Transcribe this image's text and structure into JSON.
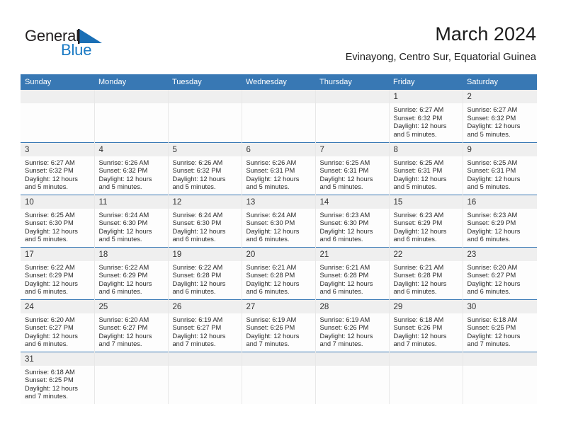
{
  "brand": {
    "name_part1": "General",
    "name_part2": "Blue",
    "logo_icon": "blue-flag-triangle",
    "color_dark": "#231f20",
    "color_blue": "#1a7ac4"
  },
  "header": {
    "month_title": "March 2024",
    "location": "Evinayong, Centro Sur, Equatorial Guinea"
  },
  "theme": {
    "header_blue": "#3878b4",
    "daynum_band": "#efefef",
    "cell_bg": "#fdfdfd",
    "text": "#2b2b2b"
  },
  "weekday_headers": [
    "Sunday",
    "Monday",
    "Tuesday",
    "Wednesday",
    "Thursday",
    "Friday",
    "Saturday"
  ],
  "weeks": [
    [
      {
        "day": "",
        "empty": true,
        "sunrise": "",
        "sunset": "",
        "daylight_line1": "",
        "daylight_line2": ""
      },
      {
        "day": "",
        "empty": true,
        "sunrise": "",
        "sunset": "",
        "daylight_line1": "",
        "daylight_line2": ""
      },
      {
        "day": "",
        "empty": true,
        "sunrise": "",
        "sunset": "",
        "daylight_line1": "",
        "daylight_line2": ""
      },
      {
        "day": "",
        "empty": true,
        "sunrise": "",
        "sunset": "",
        "daylight_line1": "",
        "daylight_line2": ""
      },
      {
        "day": "",
        "empty": true,
        "sunrise": "",
        "sunset": "",
        "daylight_line1": "",
        "daylight_line2": ""
      },
      {
        "day": "1",
        "empty": false,
        "sunrise": "Sunrise: 6:27 AM",
        "sunset": "Sunset: 6:32 PM",
        "daylight_line1": "Daylight: 12 hours",
        "daylight_line2": "and 5 minutes."
      },
      {
        "day": "2",
        "empty": false,
        "sunrise": "Sunrise: 6:27 AM",
        "sunset": "Sunset: 6:32 PM",
        "daylight_line1": "Daylight: 12 hours",
        "daylight_line2": "and 5 minutes."
      }
    ],
    [
      {
        "day": "3",
        "empty": false,
        "sunrise": "Sunrise: 6:27 AM",
        "sunset": "Sunset: 6:32 PM",
        "daylight_line1": "Daylight: 12 hours",
        "daylight_line2": "and 5 minutes."
      },
      {
        "day": "4",
        "empty": false,
        "sunrise": "Sunrise: 6:26 AM",
        "sunset": "Sunset: 6:32 PM",
        "daylight_line1": "Daylight: 12 hours",
        "daylight_line2": "and 5 minutes."
      },
      {
        "day": "5",
        "empty": false,
        "sunrise": "Sunrise: 6:26 AM",
        "sunset": "Sunset: 6:32 PM",
        "daylight_line1": "Daylight: 12 hours",
        "daylight_line2": "and 5 minutes."
      },
      {
        "day": "6",
        "empty": false,
        "sunrise": "Sunrise: 6:26 AM",
        "sunset": "Sunset: 6:31 PM",
        "daylight_line1": "Daylight: 12 hours",
        "daylight_line2": "and 5 minutes."
      },
      {
        "day": "7",
        "empty": false,
        "sunrise": "Sunrise: 6:25 AM",
        "sunset": "Sunset: 6:31 PM",
        "daylight_line1": "Daylight: 12 hours",
        "daylight_line2": "and 5 minutes."
      },
      {
        "day": "8",
        "empty": false,
        "sunrise": "Sunrise: 6:25 AM",
        "sunset": "Sunset: 6:31 PM",
        "daylight_line1": "Daylight: 12 hours",
        "daylight_line2": "and 5 minutes."
      },
      {
        "day": "9",
        "empty": false,
        "sunrise": "Sunrise: 6:25 AM",
        "sunset": "Sunset: 6:31 PM",
        "daylight_line1": "Daylight: 12 hours",
        "daylight_line2": "and 5 minutes."
      }
    ],
    [
      {
        "day": "10",
        "empty": false,
        "sunrise": "Sunrise: 6:25 AM",
        "sunset": "Sunset: 6:30 PM",
        "daylight_line1": "Daylight: 12 hours",
        "daylight_line2": "and 5 minutes."
      },
      {
        "day": "11",
        "empty": false,
        "sunrise": "Sunrise: 6:24 AM",
        "sunset": "Sunset: 6:30 PM",
        "daylight_line1": "Daylight: 12 hours",
        "daylight_line2": "and 5 minutes."
      },
      {
        "day": "12",
        "empty": false,
        "sunrise": "Sunrise: 6:24 AM",
        "sunset": "Sunset: 6:30 PM",
        "daylight_line1": "Daylight: 12 hours",
        "daylight_line2": "and 6 minutes."
      },
      {
        "day": "13",
        "empty": false,
        "sunrise": "Sunrise: 6:24 AM",
        "sunset": "Sunset: 6:30 PM",
        "daylight_line1": "Daylight: 12 hours",
        "daylight_line2": "and 6 minutes."
      },
      {
        "day": "14",
        "empty": false,
        "sunrise": "Sunrise: 6:23 AM",
        "sunset": "Sunset: 6:30 PM",
        "daylight_line1": "Daylight: 12 hours",
        "daylight_line2": "and 6 minutes."
      },
      {
        "day": "15",
        "empty": false,
        "sunrise": "Sunrise: 6:23 AM",
        "sunset": "Sunset: 6:29 PM",
        "daylight_line1": "Daylight: 12 hours",
        "daylight_line2": "and 6 minutes."
      },
      {
        "day": "16",
        "empty": false,
        "sunrise": "Sunrise: 6:23 AM",
        "sunset": "Sunset: 6:29 PM",
        "daylight_line1": "Daylight: 12 hours",
        "daylight_line2": "and 6 minutes."
      }
    ],
    [
      {
        "day": "17",
        "empty": false,
        "sunrise": "Sunrise: 6:22 AM",
        "sunset": "Sunset: 6:29 PM",
        "daylight_line1": "Daylight: 12 hours",
        "daylight_line2": "and 6 minutes."
      },
      {
        "day": "18",
        "empty": false,
        "sunrise": "Sunrise: 6:22 AM",
        "sunset": "Sunset: 6:29 PM",
        "daylight_line1": "Daylight: 12 hours",
        "daylight_line2": "and 6 minutes."
      },
      {
        "day": "19",
        "empty": false,
        "sunrise": "Sunrise: 6:22 AM",
        "sunset": "Sunset: 6:28 PM",
        "daylight_line1": "Daylight: 12 hours",
        "daylight_line2": "and 6 minutes."
      },
      {
        "day": "20",
        "empty": false,
        "sunrise": "Sunrise: 6:21 AM",
        "sunset": "Sunset: 6:28 PM",
        "daylight_line1": "Daylight: 12 hours",
        "daylight_line2": "and 6 minutes."
      },
      {
        "day": "21",
        "empty": false,
        "sunrise": "Sunrise: 6:21 AM",
        "sunset": "Sunset: 6:28 PM",
        "daylight_line1": "Daylight: 12 hours",
        "daylight_line2": "and 6 minutes."
      },
      {
        "day": "22",
        "empty": false,
        "sunrise": "Sunrise: 6:21 AM",
        "sunset": "Sunset: 6:28 PM",
        "daylight_line1": "Daylight: 12 hours",
        "daylight_line2": "and 6 minutes."
      },
      {
        "day": "23",
        "empty": false,
        "sunrise": "Sunrise: 6:20 AM",
        "sunset": "Sunset: 6:27 PM",
        "daylight_line1": "Daylight: 12 hours",
        "daylight_line2": "and 6 minutes."
      }
    ],
    [
      {
        "day": "24",
        "empty": false,
        "sunrise": "Sunrise: 6:20 AM",
        "sunset": "Sunset: 6:27 PM",
        "daylight_line1": "Daylight: 12 hours",
        "daylight_line2": "and 6 minutes."
      },
      {
        "day": "25",
        "empty": false,
        "sunrise": "Sunrise: 6:20 AM",
        "sunset": "Sunset: 6:27 PM",
        "daylight_line1": "Daylight: 12 hours",
        "daylight_line2": "and 7 minutes."
      },
      {
        "day": "26",
        "empty": false,
        "sunrise": "Sunrise: 6:19 AM",
        "sunset": "Sunset: 6:27 PM",
        "daylight_line1": "Daylight: 12 hours",
        "daylight_line2": "and 7 minutes."
      },
      {
        "day": "27",
        "empty": false,
        "sunrise": "Sunrise: 6:19 AM",
        "sunset": "Sunset: 6:26 PM",
        "daylight_line1": "Daylight: 12 hours",
        "daylight_line2": "and 7 minutes."
      },
      {
        "day": "28",
        "empty": false,
        "sunrise": "Sunrise: 6:19 AM",
        "sunset": "Sunset: 6:26 PM",
        "daylight_line1": "Daylight: 12 hours",
        "daylight_line2": "and 7 minutes."
      },
      {
        "day": "29",
        "empty": false,
        "sunrise": "Sunrise: 6:18 AM",
        "sunset": "Sunset: 6:26 PM",
        "daylight_line1": "Daylight: 12 hours",
        "daylight_line2": "and 7 minutes."
      },
      {
        "day": "30",
        "empty": false,
        "sunrise": "Sunrise: 6:18 AM",
        "sunset": "Sunset: 6:25 PM",
        "daylight_line1": "Daylight: 12 hours",
        "daylight_line2": "and 7 minutes."
      }
    ],
    [
      {
        "day": "31",
        "empty": false,
        "sunrise": "Sunrise: 6:18 AM",
        "sunset": "Sunset: 6:25 PM",
        "daylight_line1": "Daylight: 12 hours",
        "daylight_line2": "and 7 minutes."
      },
      {
        "day": "",
        "empty": true,
        "sunrise": "",
        "sunset": "",
        "daylight_line1": "",
        "daylight_line2": ""
      },
      {
        "day": "",
        "empty": true,
        "sunrise": "",
        "sunset": "",
        "daylight_line1": "",
        "daylight_line2": ""
      },
      {
        "day": "",
        "empty": true,
        "sunrise": "",
        "sunset": "",
        "daylight_line1": "",
        "daylight_line2": ""
      },
      {
        "day": "",
        "empty": true,
        "sunrise": "",
        "sunset": "",
        "daylight_line1": "",
        "daylight_line2": ""
      },
      {
        "day": "",
        "empty": true,
        "sunrise": "",
        "sunset": "",
        "daylight_line1": "",
        "daylight_line2": ""
      },
      {
        "day": "",
        "empty": true,
        "sunrise": "",
        "sunset": "",
        "daylight_line1": "",
        "daylight_line2": ""
      }
    ]
  ]
}
